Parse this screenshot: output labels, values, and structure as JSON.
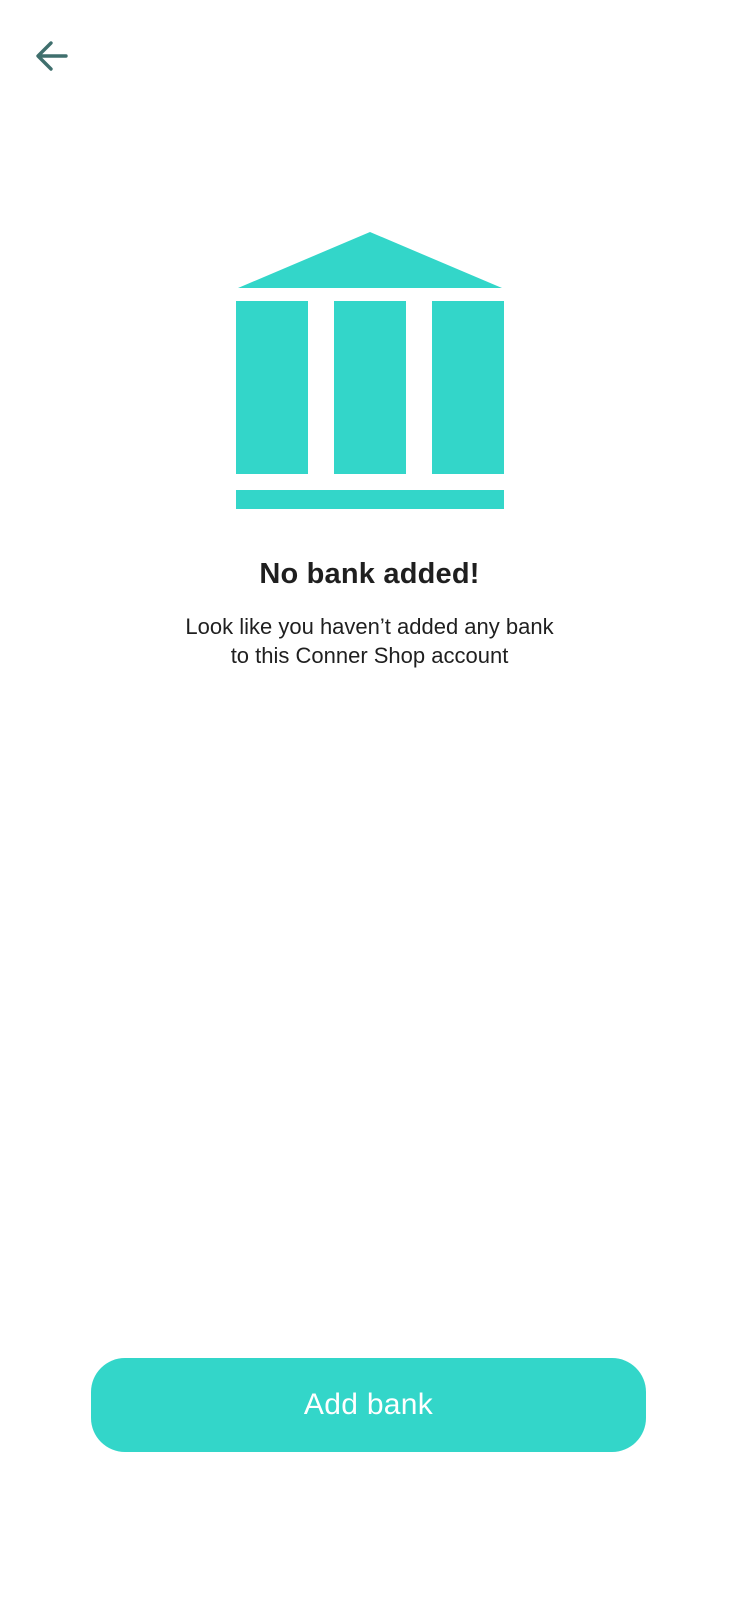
{
  "header": {
    "back_icon": "arrow-left-icon"
  },
  "illustration": {
    "icon": "bank-icon",
    "color": "#33d6c9"
  },
  "empty_state": {
    "title": "No bank added!",
    "message_line1": "Look like you haven’t added any bank",
    "message_line2": "to this Conner Shop account"
  },
  "actions": {
    "add_bank_label": "Add bank"
  },
  "colors": {
    "accent": "#33d6c9",
    "back_icon": "#3f6f6d",
    "text": "#1f1f1f",
    "background": "#ffffff"
  }
}
